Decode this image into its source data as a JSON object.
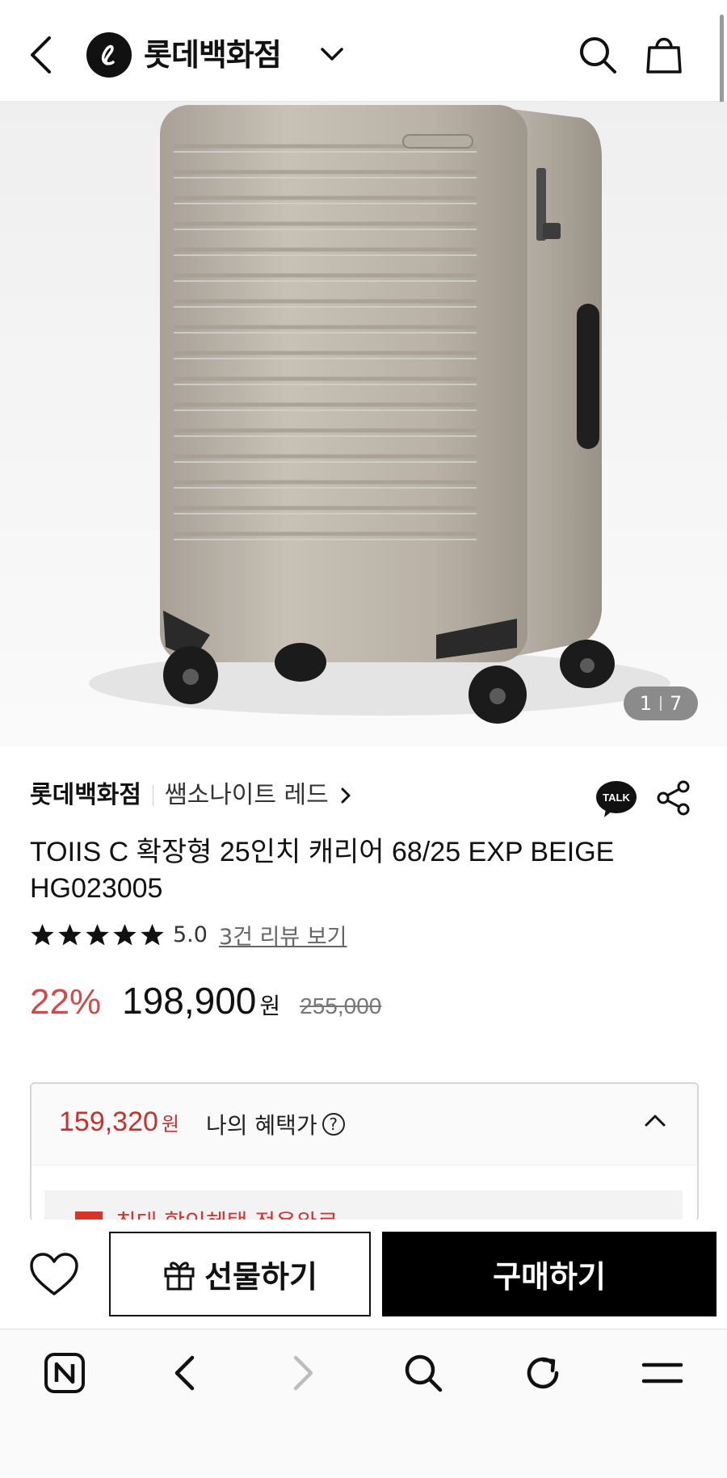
{
  "header": {
    "brand_title": "롯데백화점",
    "icons": [
      "back-icon",
      "brand-logo-icon",
      "chevron-down-icon",
      "search-icon",
      "shopping-bag-icon"
    ]
  },
  "gallery": {
    "current": "1",
    "total": "7"
  },
  "product": {
    "store": "롯데백화점",
    "brand_line": "쌤소나이트 레드",
    "title_line1": "TOIIS C 확장형 25인치 캐리어 68/25 EXP BEIGE",
    "title_line2": "HG023005",
    "stars": 5,
    "score": "5.0",
    "review_link": "3건 리뷰 보기",
    "discount": "22%",
    "price": "198,900",
    "currency": "원",
    "original_price": "255,000"
  },
  "benefit": {
    "price": "159,320",
    "currency": "원",
    "label": "나의 혜택가",
    "help": "?",
    "partial_text": "최대 할인혜택 적용완료"
  },
  "actions": {
    "gift_label": "선물하기",
    "buy_label": "구매하기"
  },
  "colors": {
    "accent_red": "#d2494a",
    "buy_button": "#000000"
  }
}
